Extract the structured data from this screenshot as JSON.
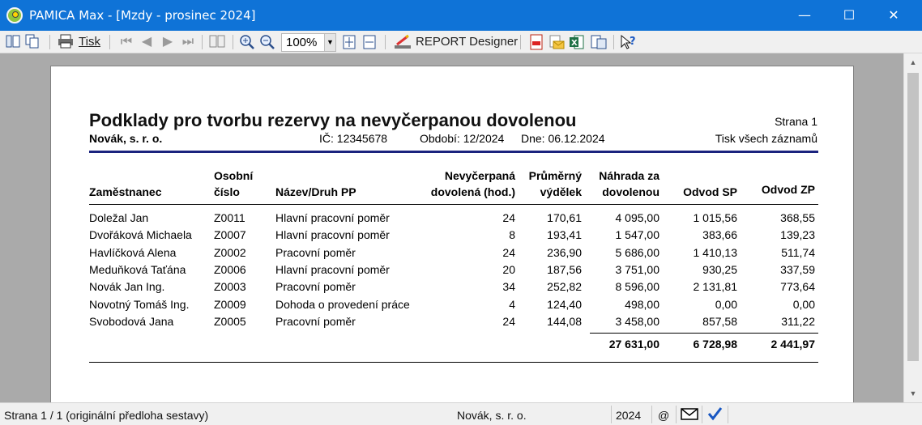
{
  "window": {
    "title": "PAMICA Max - [Mzdy - prosinec 2024]",
    "minimize": "—",
    "maximize": "☐",
    "close": "✕"
  },
  "toolbar": {
    "print_label": "Tisk",
    "zoom_value": "100%",
    "report_designer_label": "REPORT Designer",
    "icons": [
      "panels-icon",
      "copy-pages-icon",
      "printer-icon",
      "first-page-icon",
      "prev-page-icon",
      "next-page-icon",
      "last-page-icon",
      "two-pages-icon",
      "zoom-in-icon",
      "zoom-out-icon",
      "fit-page-icon",
      "fit-width-icon",
      "report-designer-icon",
      "export-pdf-icon",
      "email-icon",
      "export-excel-icon",
      "export-doc-icon",
      "help-icon"
    ]
  },
  "report": {
    "title": "Podklady pro tvorbu rezervy na nevyčerpanou dovolenou",
    "company": "Novák, s. r. o.",
    "ic": "IČ: 12345678",
    "period": "Období: 12/2024",
    "date": "Dne: 06.12.2024",
    "page": "Strana 1",
    "print_scope": "Tisk všech záznamů",
    "headers": {
      "employee": "Zaměstnanec",
      "personal_no_1": "Osobní",
      "personal_no_2": "číslo",
      "contract": "Název/Druh PP",
      "unused_1": "Nevyčerpaná",
      "unused_2": "dovolená (hod.)",
      "avg_1": "Průměrný",
      "avg_2": "výdělek",
      "comp_1": "Náhrada za",
      "comp_2": "dovolenou",
      "sp": "Odvod SP",
      "zp": "Odvod ZP"
    },
    "rows": [
      {
        "name": "Doležal Jan",
        "id": "Z0011",
        "pp": "Hlavní pracovní poměr",
        "hours": "24",
        "avg": "170,61",
        "comp": "4 095,00",
        "sp": "1 015,56",
        "zp": "368,55"
      },
      {
        "name": "Dvořáková Michaela",
        "id": "Z0007",
        "pp": "Hlavní pracovní poměr",
        "hours": "8",
        "avg": "193,41",
        "comp": "1 547,00",
        "sp": "383,66",
        "zp": "139,23"
      },
      {
        "name": "Havlíčková Alena",
        "id": "Z0002",
        "pp": "Pracovní poměr",
        "hours": "24",
        "avg": "236,90",
        "comp": "5 686,00",
        "sp": "1 410,13",
        "zp": "511,74"
      },
      {
        "name": "Meduňková Taťána",
        "id": "Z0006",
        "pp": "Hlavní pracovní poměr",
        "hours": "20",
        "avg": "187,56",
        "comp": "3 751,00",
        "sp": "930,25",
        "zp": "337,59"
      },
      {
        "name": "Novák Jan Ing.",
        "id": "Z0003",
        "pp": "Pracovní poměr",
        "hours": "34",
        "avg": "252,82",
        "comp": "8 596,00",
        "sp": "2 131,81",
        "zp": "773,64"
      },
      {
        "name": "Novotný Tomáš Ing.",
        "id": "Z0009",
        "pp": "Dohoda o provedení práce",
        "hours": "4",
        "avg": "124,40",
        "comp": "498,00",
        "sp": "0,00",
        "zp": "0,00"
      },
      {
        "name": "Svobodová Jana",
        "id": "Z0005",
        "pp": "Pracovní poměr",
        "hours": "24",
        "avg": "144,08",
        "comp": "3 458,00",
        "sp": "857,58",
        "zp": "311,22"
      }
    ],
    "totals": {
      "comp": "27 631,00",
      "sp": "6 728,98",
      "zp": "2 441,97"
    }
  },
  "statusbar": {
    "page_info": "Strana 1 / 1  (originální předloha sestavy)",
    "company": "Novák, s. r. o.",
    "year": "2024",
    "at": "@"
  },
  "colors": {
    "titlebar": "#0f73d7",
    "workarea": "#aaaaaa",
    "report_rule": "#1a237e"
  }
}
